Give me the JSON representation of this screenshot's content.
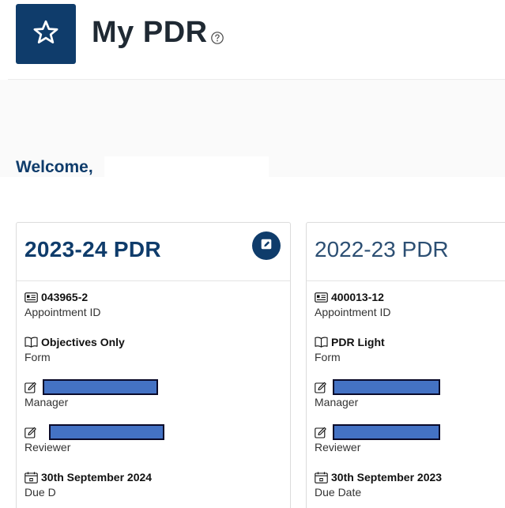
{
  "header": {
    "title": "My PDR",
    "logo_icon": "star-icon",
    "help_icon": "help-circle-icon"
  },
  "welcome": {
    "text": "Welcome,"
  },
  "cards": [
    {
      "title": "2023-24 PDR",
      "fields": {
        "appointment_id": {
          "value": "043965-2",
          "label": "Appointment ID"
        },
        "form": {
          "value": "Objectives Only",
          "label": "Form"
        },
        "manager": {
          "label": "Manager"
        },
        "reviewer": {
          "label": "Reviewer"
        },
        "due_date": {
          "value": "30th September 2024",
          "label": "Due D"
        }
      }
    },
    {
      "title": "2022-23 PDR",
      "fields": {
        "appointment_id": {
          "value": "400013-12",
          "label": "Appointment ID"
        },
        "form": {
          "value": "PDR Light",
          "label": "Form"
        },
        "manager": {
          "label": "Manager"
        },
        "reviewer": {
          "label": "Reviewer"
        },
        "due_date": {
          "value": "30th September 2023",
          "label": "Due Date"
        }
      }
    }
  ],
  "colors": {
    "brand_navy": "#0f3c6b",
    "redaction_blue": "#4472c4"
  }
}
